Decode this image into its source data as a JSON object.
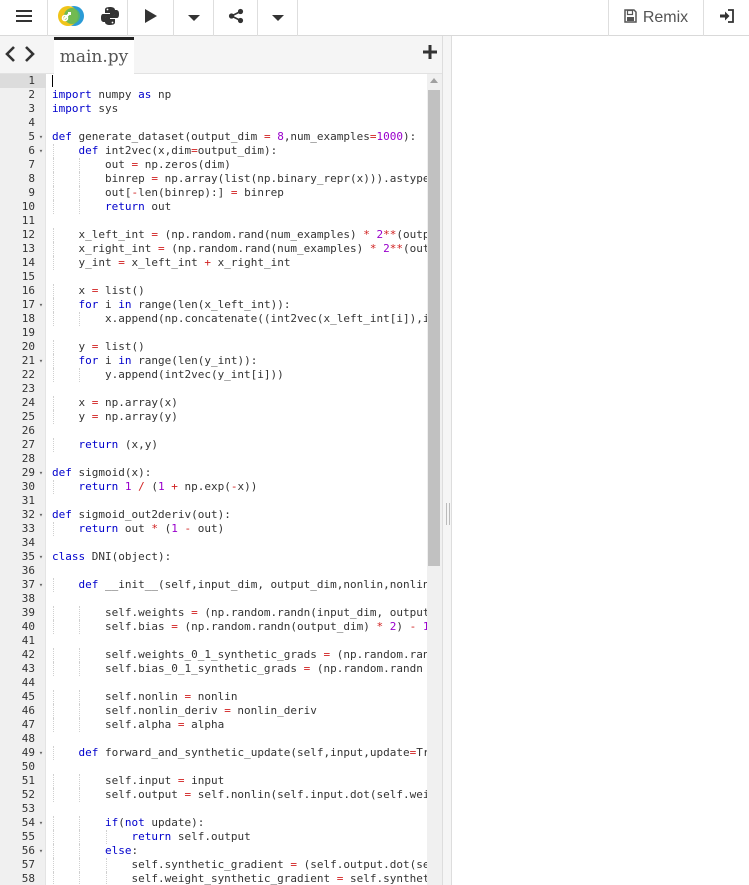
{
  "toolbar": {
    "menu_icon": "hamburger-icon",
    "language_icons": [
      "python-logo-icon",
      "python-snake-icon"
    ],
    "run_icon": "play-icon",
    "share_icon": "share-icon",
    "remix_label": "Remix",
    "remix_icon": "save-icon",
    "login_icon": "sign-in-icon"
  },
  "tabs": {
    "active_file": "main.py"
  },
  "editor": {
    "active_line": 1,
    "lines": [
      {
        "n": 1,
        "code": ""
      },
      {
        "n": 2,
        "code": "import numpy as np"
      },
      {
        "n": 3,
        "code": "import sys"
      },
      {
        "n": 4,
        "code": ""
      },
      {
        "n": 5,
        "code": "def generate_dataset(output_dim = 8,num_examples=1000):",
        "fold": true
      },
      {
        "n": 6,
        "code": "    def int2vec(x,dim=output_dim):",
        "fold": true
      },
      {
        "n": 7,
        "code": "        out = np.zeros(dim)"
      },
      {
        "n": 8,
        "code": "        binrep = np.array(list(np.binary_repr(x))).astype"
      },
      {
        "n": 9,
        "code": "        out[-len(binrep):] = binrep"
      },
      {
        "n": 10,
        "code": "        return out"
      },
      {
        "n": 11,
        "code": ""
      },
      {
        "n": 12,
        "code": "    x_left_int = (np.random.rand(num_examples) * 2**(outp"
      },
      {
        "n": 13,
        "code": "    x_right_int = (np.random.rand(num_examples) * 2**(out"
      },
      {
        "n": 14,
        "code": "    y_int = x_left_int + x_right_int"
      },
      {
        "n": 15,
        "code": ""
      },
      {
        "n": 16,
        "code": "    x = list()"
      },
      {
        "n": 17,
        "code": "    for i in range(len(x_left_int)):",
        "fold": true
      },
      {
        "n": 18,
        "code": "        x.append(np.concatenate((int2vec(x_left_int[i]),i"
      },
      {
        "n": 19,
        "code": ""
      },
      {
        "n": 20,
        "code": "    y = list()"
      },
      {
        "n": 21,
        "code": "    for i in range(len(y_int)):",
        "fold": true
      },
      {
        "n": 22,
        "code": "        y.append(int2vec(y_int[i]))"
      },
      {
        "n": 23,
        "code": ""
      },
      {
        "n": 24,
        "code": "    x = np.array(x)"
      },
      {
        "n": 25,
        "code": "    y = np.array(y)"
      },
      {
        "n": 26,
        "code": ""
      },
      {
        "n": 27,
        "code": "    return (x,y)"
      },
      {
        "n": 28,
        "code": ""
      },
      {
        "n": 29,
        "code": "def sigmoid(x):",
        "fold": true
      },
      {
        "n": 30,
        "code": "    return 1 / (1 + np.exp(-x))"
      },
      {
        "n": 31,
        "code": ""
      },
      {
        "n": 32,
        "code": "def sigmoid_out2deriv(out):",
        "fold": true
      },
      {
        "n": 33,
        "code": "    return out * (1 - out)"
      },
      {
        "n": 34,
        "code": ""
      },
      {
        "n": 35,
        "code": "class DNI(object):",
        "fold": true
      },
      {
        "n": 36,
        "code": ""
      },
      {
        "n": 37,
        "code": "    def __init__(self,input_dim, output_dim,nonlin,nonlin",
        "fold": true
      },
      {
        "n": 38,
        "code": ""
      },
      {
        "n": 39,
        "code": "        self.weights = (np.random.randn(input_dim, output"
      },
      {
        "n": 40,
        "code": "        self.bias = (np.random.randn(output_dim) * 2) - 1"
      },
      {
        "n": 41,
        "code": ""
      },
      {
        "n": 42,
        "code": "        self.weights_0_1_synthetic_grads = (np.random.ran"
      },
      {
        "n": 43,
        "code": "        self.bias_0_1_synthetic_grads = (np.random.randn"
      },
      {
        "n": 44,
        "code": ""
      },
      {
        "n": 45,
        "code": "        self.nonlin = nonlin"
      },
      {
        "n": 46,
        "code": "        self.nonlin_deriv = nonlin_deriv"
      },
      {
        "n": 47,
        "code": "        self.alpha = alpha"
      },
      {
        "n": 48,
        "code": ""
      },
      {
        "n": 49,
        "code": "    def forward_and_synthetic_update(self,input,update=Tr",
        "fold": true
      },
      {
        "n": 50,
        "code": ""
      },
      {
        "n": 51,
        "code": "        self.input = input"
      },
      {
        "n": 52,
        "code": "        self.output = self.nonlin(self.input.dot(self.wei"
      },
      {
        "n": 53,
        "code": ""
      },
      {
        "n": 54,
        "code": "        if(not update):",
        "fold": true
      },
      {
        "n": 55,
        "code": "            return self.output"
      },
      {
        "n": 56,
        "code": "        else:",
        "fold": true
      },
      {
        "n": 57,
        "code": "            self.synthetic_gradient = (self.output.dot(se"
      },
      {
        "n": 58,
        "code": "            self.weight_synthetic_gradient = self.synthet"
      }
    ]
  }
}
